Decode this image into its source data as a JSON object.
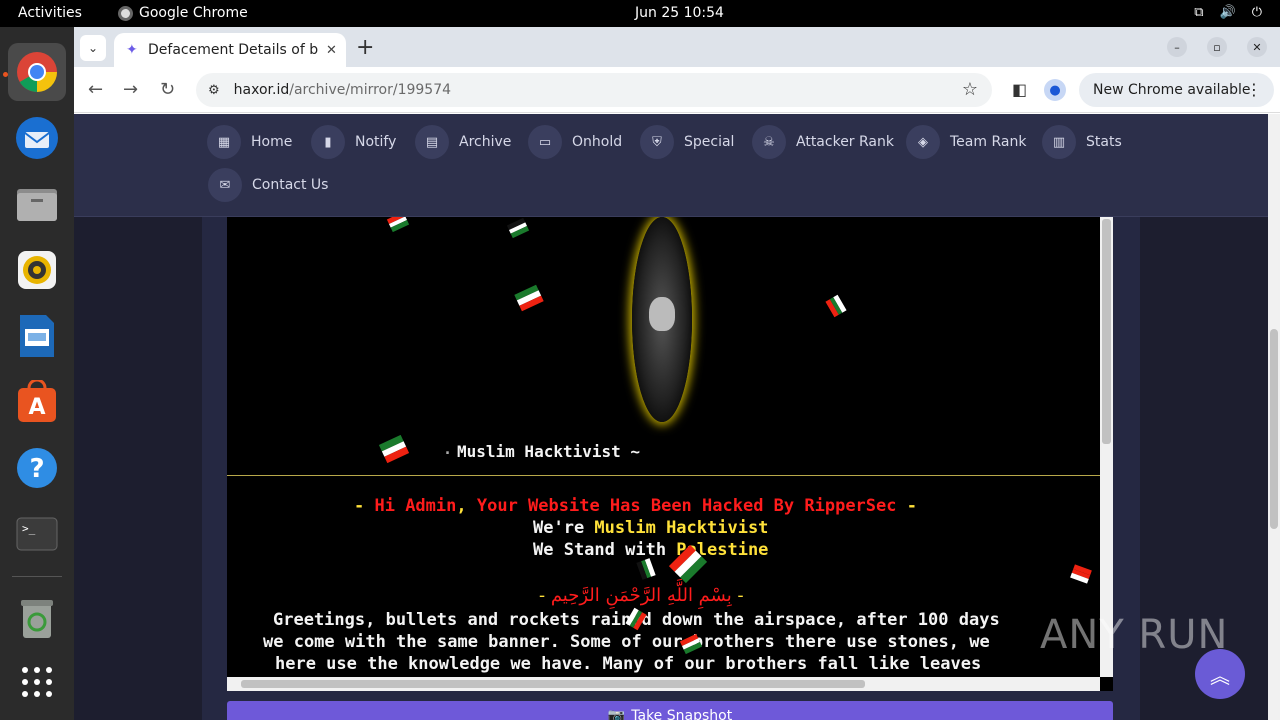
{
  "topbar": {
    "activities": "Activities",
    "app_name": "Google Chrome",
    "clock": "Jun 25  10:54"
  },
  "dock": {
    "items": [
      "Google Chrome",
      "Thunderbird",
      "Files",
      "Rhythmbox",
      "LibreOffice Impress",
      "Ubuntu Software",
      "Help",
      "Terminal",
      "Trash",
      "Show Applications"
    ]
  },
  "browser": {
    "tab_title": "Defacement Details of b",
    "url_host": "haxor.id",
    "url_path": "/archive/mirror/199574",
    "update_label": "New Chrome available"
  },
  "site_nav": {
    "items": [
      {
        "label": "Home",
        "icon": "grid-icon"
      },
      {
        "label": "Notify",
        "icon": "bookmark-icon"
      },
      {
        "label": "Archive",
        "icon": "book-icon"
      },
      {
        "label": "Onhold",
        "icon": "file-icon"
      },
      {
        "label": "Special",
        "icon": "shield-icon"
      },
      {
        "label": "Attacker Rank",
        "icon": "skull-icon"
      },
      {
        "label": "Team Rank",
        "icon": "layers-icon"
      },
      {
        "label": "Stats",
        "icon": "chart-icon"
      },
      {
        "label": "Contact Us",
        "icon": "mail-icon"
      }
    ]
  },
  "mirror": {
    "subtitle": "Muslim Hacktivist ~",
    "line1_dash_left": "- ",
    "line1_a": "Hi Admin",
    "line1_comma": ", ",
    "line1_b": "Your Website Has Been Hacked By RipperSec",
    "line1_dash_right": " -",
    "line2_a": "We're ",
    "line2_b": "Muslim Hacktivist",
    "line3_a": "We Stand with ",
    "line3_b": "Palestine",
    "arabic_dash_left": "- ",
    "arabic": "بِسْمِ اللَّهِ الرَّحْمَنِ الرَّحِيم",
    "arabic_dash_right": " -",
    "para1": "Greetings, bullets and rockets rained down the airspace, after 100 days",
    "para2": "we come with the same banner. Some of our brothers there use stones, we",
    "para3": "here use the knowledge we have. Many of our brothers fall like leaves"
  },
  "snapshot_label": "Take Snapshot",
  "watermark": "ANY RUN",
  "colors": {
    "nav_bg": "#2c2f4a",
    "accent": "#6e59d9",
    "hack_red": "#ff1c1c",
    "hack_yellow": "#ffe13a"
  }
}
